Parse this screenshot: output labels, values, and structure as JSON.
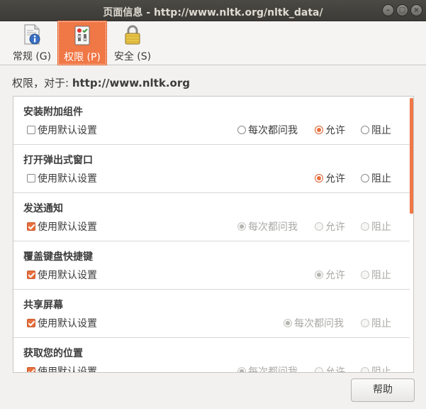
{
  "window": {
    "title": "页面信息 - http://www.nltk.org/nltk_data/",
    "min_glyph": "–",
    "max_glyph": "□",
    "close_glyph": "×"
  },
  "toolbar": {
    "tabs": [
      {
        "label": "常规 (G)",
        "icon": "page-info-icon",
        "selected": false
      },
      {
        "label": "权限 (P)",
        "icon": "permissions-icon",
        "selected": true
      },
      {
        "label": "安全 (S)",
        "icon": "padlock-icon",
        "selected": false
      }
    ]
  },
  "heading": {
    "prefix": "权限，对于: ",
    "site": "http://www.nltk.org"
  },
  "permissions": [
    {
      "title": "安装附加组件",
      "use_default": {
        "label": "使用默认设置",
        "checked": false
      },
      "options": [
        {
          "label": "每次都问我",
          "selected": false,
          "disabled": false
        },
        {
          "label": "允许",
          "selected": true,
          "disabled": false
        },
        {
          "label": "阻止",
          "selected": false,
          "disabled": false
        }
      ]
    },
    {
      "title": "打开弹出式窗口",
      "use_default": {
        "label": "使用默认设置",
        "checked": false
      },
      "options": [
        {
          "label": "允许",
          "selected": true,
          "disabled": false
        },
        {
          "label": "阻止",
          "selected": false,
          "disabled": false
        }
      ]
    },
    {
      "title": "发送通知",
      "use_default": {
        "label": "使用默认设置",
        "checked": true
      },
      "options": [
        {
          "label": "每次都问我",
          "selected": true,
          "disabled": true
        },
        {
          "label": "允许",
          "selected": false,
          "disabled": true
        },
        {
          "label": "阻止",
          "selected": false,
          "disabled": true
        }
      ]
    },
    {
      "title": "覆盖键盘快捷键",
      "use_default": {
        "label": "使用默认设置",
        "checked": true
      },
      "options": [
        {
          "label": "允许",
          "selected": true,
          "disabled": true
        },
        {
          "label": "阻止",
          "selected": false,
          "disabled": true
        }
      ]
    },
    {
      "title": "共享屏幕",
      "use_default": {
        "label": "使用默认设置",
        "checked": true
      },
      "options": [
        {
          "label": "每次都问我",
          "selected": true,
          "disabled": true
        },
        {
          "label": "阻止",
          "selected": false,
          "disabled": true
        }
      ]
    },
    {
      "title": "获取您的位置",
      "use_default": {
        "label": "使用默认设置",
        "checked": true
      },
      "options": [
        {
          "label": "每次都问我",
          "selected": true,
          "disabled": true
        },
        {
          "label": "允许",
          "selected": false,
          "disabled": true
        },
        {
          "label": "阻止",
          "selected": false,
          "disabled": true
        }
      ]
    }
  ],
  "footer": {
    "help_label": "帮助"
  },
  "colors": {
    "accent": "#f07746",
    "titlebar": "#3c3b37"
  }
}
